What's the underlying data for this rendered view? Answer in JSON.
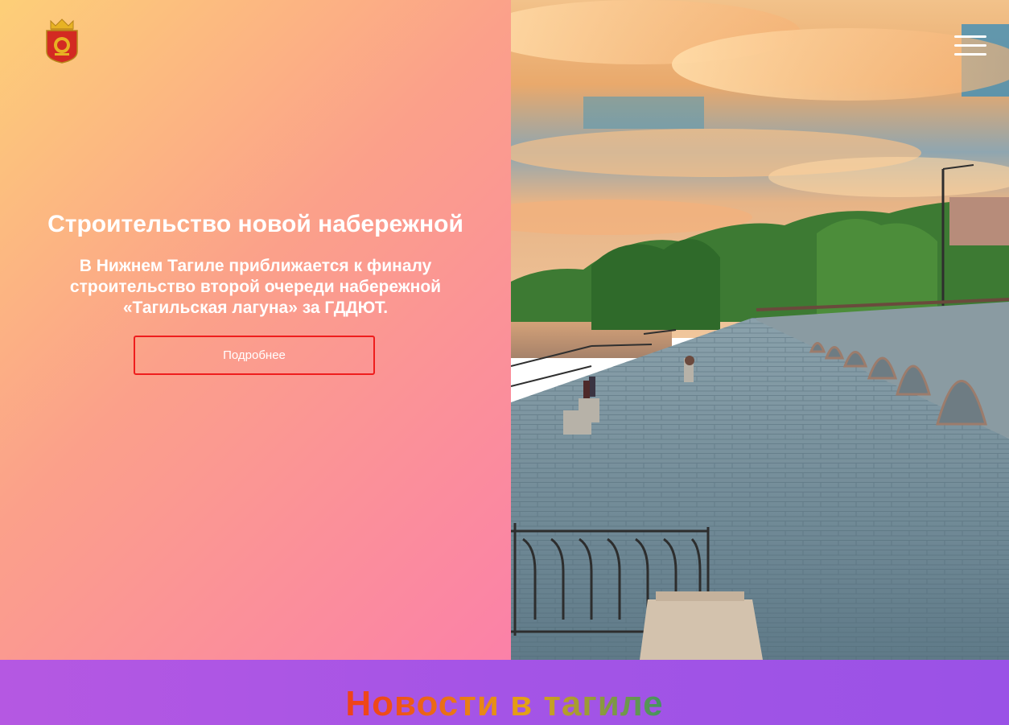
{
  "header": {
    "logo_icon": "coat-of-arms-icon",
    "menu_icon": "hamburger-menu-icon"
  },
  "hero": {
    "title": "Строительство новой набережной",
    "text": "В Нижнем Тагиле приближается к финалу строительство второй очереди набережной «Тагильская лагуна» за ГДДЮТ.",
    "button_label": "Подробнее",
    "button_border_color": "#ef1d1d",
    "gradient_colors": [
      "#fdcf78",
      "#fba08a",
      "#fb81a8"
    ]
  },
  "news": {
    "title": "Новости в тагиле",
    "background_color": "#a454e6"
  }
}
